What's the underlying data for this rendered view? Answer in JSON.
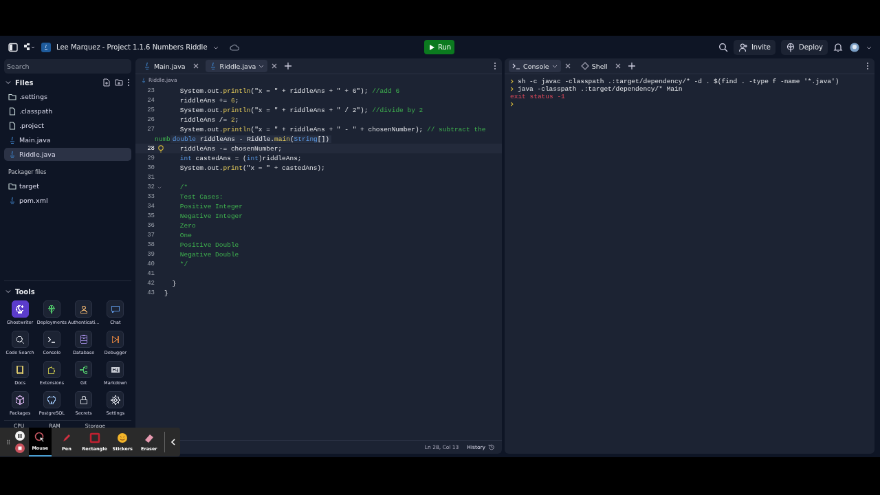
{
  "topbar": {
    "title": "Lee Marquez - Project 1.1.6 Numbers Riddle",
    "run_label": "Run",
    "invite_label": "Invite",
    "deploy_label": "Deploy"
  },
  "sidebar": {
    "search": {
      "placeholder": "Search"
    },
    "files_title": "Files",
    "files": [
      {
        "name": ".settings",
        "kind": "folder",
        "selected": false
      },
      {
        "name": ".classpath",
        "kind": "file",
        "selected": false
      },
      {
        "name": ".project",
        "kind": "file",
        "selected": false
      },
      {
        "name": "Main.java",
        "kind": "java",
        "selected": false
      },
      {
        "name": "Riddle.java",
        "kind": "java",
        "selected": true
      }
    ],
    "packager_title": "Packager files",
    "packager_files": [
      {
        "name": "target",
        "kind": "folder",
        "selected": false
      },
      {
        "name": "pom.xml",
        "kind": "java",
        "selected": false
      }
    ],
    "tools_title": "Tools",
    "tools": [
      {
        "label": "Ghostwriter",
        "kind": "sparkle",
        "color": "#ffffff",
        "selected": true
      },
      {
        "label": "Deployments",
        "kind": "tree",
        "color": "#4fc36a",
        "selected": false
      },
      {
        "label": "Authenticati...",
        "kind": "person",
        "color": "#d9a66a",
        "selected": false
      },
      {
        "label": "Chat",
        "kind": "chat",
        "color": "#5a8fd6",
        "selected": false
      },
      {
        "label": "Code Search",
        "kind": "search",
        "color": "#c9ccd4",
        "selected": false
      },
      {
        "label": "Console",
        "kind": "terminal",
        "color": "#c9ccd4",
        "selected": false
      },
      {
        "label": "Database",
        "kind": "database",
        "color": "#9b86d9",
        "selected": false
      },
      {
        "label": "Debugger",
        "kind": "step",
        "color": "#c9773d",
        "selected": false
      },
      {
        "label": "Docs",
        "kind": "book",
        "color": "#d8c56a",
        "selected": false
      },
      {
        "label": "Extensions",
        "kind": "puzzle",
        "color": "#b9b84a",
        "selected": false
      },
      {
        "label": "Git",
        "kind": "branch",
        "color": "#4fc36a",
        "selected": false
      },
      {
        "label": "Markdown",
        "kind": "markdown",
        "color": "#c9ccd4",
        "selected": false
      },
      {
        "label": "Packages",
        "kind": "cube",
        "color": "#c9a9e0",
        "selected": false
      },
      {
        "label": "PostgreSQL",
        "kind": "elephant",
        "color": "#8fb3e0",
        "selected": false
      },
      {
        "label": "Secrets",
        "kind": "lock",
        "color": "#c9ccd4",
        "selected": false
      },
      {
        "label": "Settings",
        "kind": "settings",
        "color": "#c9ccd4",
        "selected": false
      }
    ],
    "resources": [
      "CPU",
      "RAM",
      "Storage"
    ]
  },
  "editor": {
    "tabs": [
      {
        "label": "Main.java",
        "selected": false
      },
      {
        "label": "Riddle.java",
        "selected": true
      }
    ],
    "breadcrumb": "Riddle.java",
    "lines": [
      {
        "number": "23",
        "current": false,
        "tokens": [
          {
            "t": "    System.out.",
            "kind": "code"
          },
          {
            "t": "println",
            "kind": "fn"
          },
          {
            "t": "(\"x = \" + riddleAns + \" + 6\"); ",
            "kind": "code"
          },
          {
            "t": "//add 6",
            "kind": "cmt"
          }
        ]
      },
      {
        "number": "24",
        "current": false,
        "tokens": [
          {
            "t": "    riddleAns += ",
            "kind": "code"
          },
          {
            "t": "6",
            "kind": "num"
          },
          {
            "t": ";",
            "kind": "code"
          }
        ]
      },
      {
        "number": "25",
        "current": false,
        "tokens": [
          {
            "t": "    System.out.",
            "kind": "code"
          },
          {
            "t": "println",
            "kind": "fn"
          },
          {
            "t": "(\"x = \" + riddleAns + \" / 2\"); ",
            "kind": "code"
          },
          {
            "t": "//divide by 2",
            "kind": "cmt"
          }
        ]
      },
      {
        "number": "26",
        "current": false,
        "tokens": [
          {
            "t": "    riddleAns /= ",
            "kind": "code"
          },
          {
            "t": "2",
            "kind": "num"
          },
          {
            "t": ";",
            "kind": "code"
          }
        ]
      },
      {
        "number": "27",
        "current": false,
        "tokens": [
          {
            "t": "    System.out.",
            "kind": "code"
          },
          {
            "t": "println",
            "kind": "fn"
          },
          {
            "t": "(\"x = \" + riddleAns + \" - \" + chosenNumber); ",
            "kind": "code"
          },
          {
            "t": "// subtract the",
            "kind": "cmt"
          }
        ],
        "wrap": "numb",
        "hover": [
          {
            "t": "double",
            "kind": "kw"
          },
          {
            "t": " riddleAns - Riddle.",
            "kind": "code"
          },
          {
            "t": "main",
            "kind": "fn"
          },
          {
            "t": "(",
            "kind": "code"
          },
          {
            "t": "String",
            "kind": "kw"
          },
          {
            "t": "[])",
            "kind": "code"
          }
        ]
      },
      {
        "number": "28",
        "current": true,
        "bulb": true,
        "tokens": [
          {
            "t": "    riddleAns -= chosenNumber;",
            "kind": "code"
          }
        ]
      },
      {
        "number": "29",
        "current": false,
        "tokens": [
          {
            "t": "    int",
            "kind": "kw"
          },
          {
            "t": " castedAns = (",
            "kind": "code"
          },
          {
            "t": "int",
            "kind": "kw"
          },
          {
            "t": ")riddleAns;",
            "kind": "code"
          }
        ]
      },
      {
        "number": "30",
        "current": false,
        "tokens": [
          {
            "t": "    System.out.",
            "kind": "code"
          },
          {
            "t": "print",
            "kind": "fn"
          },
          {
            "t": "(\"x = \" + castedAns);",
            "kind": "code"
          }
        ]
      },
      {
        "number": "31",
        "current": false
      },
      {
        "number": "32",
        "current": false,
        "fold": true,
        "tokens": [
          {
            "t": "    /*",
            "kind": "cmt"
          }
        ]
      },
      {
        "number": "33",
        "current": false,
        "tokens": [
          {
            "t": "    Test Cases:",
            "kind": "cmt"
          }
        ]
      },
      {
        "number": "34",
        "current": false,
        "tokens": [
          {
            "t": "    Positive Integer",
            "kind": "cmt"
          }
        ]
      },
      {
        "number": "35",
        "current": false,
        "tokens": [
          {
            "t": "    Negative Integer",
            "kind": "cmt"
          }
        ]
      },
      {
        "number": "36",
        "current": false,
        "tokens": [
          {
            "t": "    Zero",
            "kind": "cmt"
          }
        ]
      },
      {
        "number": "37",
        "current": false,
        "tokens": [
          {
            "t": "    One",
            "kind": "cmt"
          }
        ]
      },
      {
        "number": "38",
        "current": false,
        "tokens": [
          {
            "t": "    Positive Double",
            "kind": "cmt"
          }
        ]
      },
      {
        "number": "39",
        "current": false,
        "tokens": [
          {
            "t": "    Negative Double",
            "kind": "cmt"
          }
        ]
      },
      {
        "number": "40",
        "current": false,
        "tokens": [
          {
            "t": "    */",
            "kind": "cmt"
          }
        ]
      },
      {
        "number": "41",
        "current": false
      },
      {
        "number": "42",
        "current": false,
        "tokens": [
          {
            "t": "  }",
            "kind": "code"
          }
        ]
      },
      {
        "number": "43",
        "current": false,
        "tokens": [
          {
            "t": "}",
            "kind": "code"
          }
        ]
      }
    ],
    "status": {
      "position": "Ln 28, Col 13",
      "history": "History"
    }
  },
  "console": {
    "tabs": [
      {
        "label": "Console",
        "selected": true
      },
      {
        "label": "Shell",
        "selected": false
      }
    ],
    "lines": [
      {
        "kind": "command",
        "text": "sh -c javac -classpath .:target/dependency/* -d . $(find . -type f -name '*.java')"
      },
      {
        "kind": "command",
        "text": "java -classpath .:target/dependency/* Main"
      },
      {
        "kind": "error",
        "text": "exit status -1"
      },
      {
        "kind": "prompt"
      }
    ]
  },
  "annotation_toolbar": {
    "tools": [
      {
        "label": "Mouse",
        "kind": "mouse",
        "selected": true
      },
      {
        "label": "Pen",
        "kind": "pen",
        "selected": false
      },
      {
        "label": "Rectangle",
        "kind": "rectangle",
        "selected": false
      },
      {
        "label": "Stickers",
        "kind": "sticker",
        "selected": false
      },
      {
        "label": "Eraser",
        "kind": "eraser",
        "selected": false
      }
    ]
  }
}
